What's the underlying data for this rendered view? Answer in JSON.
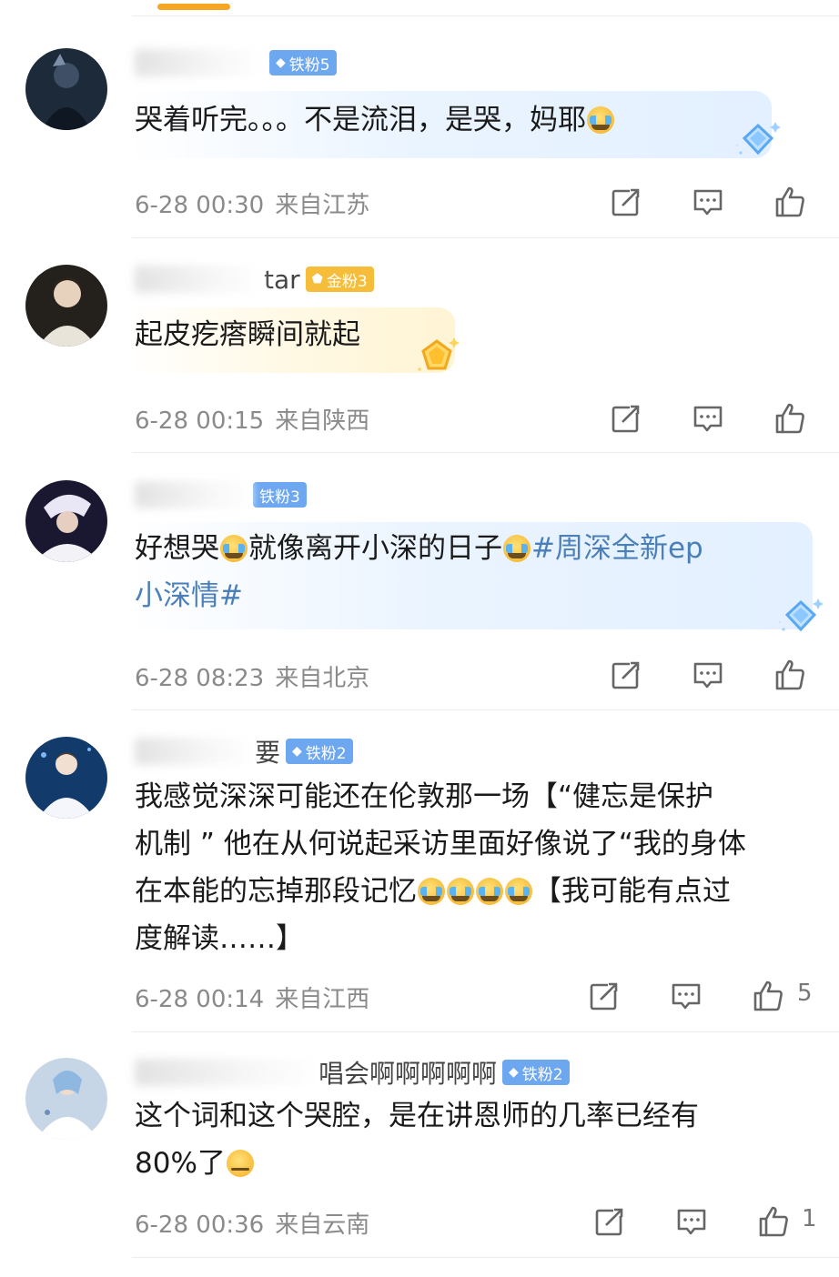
{
  "comments": [
    {
      "name_visible": "",
      "badge": "铁粉5",
      "badge_kind": "iron",
      "text": "哭着听完。。。不是流泪，是哭，妈耶",
      "time": "6-28 00:30",
      "location": "来自江苏",
      "likes": ""
    },
    {
      "name_visible": "tar",
      "badge": "金粉3",
      "badge_kind": "gold",
      "text": "起皮疙瘩瞬间就起",
      "time": "6-28 00:15",
      "location": "来自陕西",
      "likes": ""
    },
    {
      "name_visible": "",
      "badge": "铁粉3",
      "badge_kind": "iron",
      "text_part1": "好想哭",
      "text_part2": "就像离开小深的日子",
      "hashtag_line1": "#周深全新ep",
      "hashtag_line2": "小深情#",
      "time": "6-28 08:23",
      "location": "来自北京",
      "likes": ""
    },
    {
      "name_visible": "要",
      "badge": "铁粉2",
      "badge_kind": "iron",
      "line1": "我感觉深深可能还在伦敦那一场【“健忘是保护",
      "line2": "机制 ” 他在从何说起采访里面好像说了“我的身体",
      "line3a": "在本能的忘掉那段记忆",
      "line3b": "【我可能有点过",
      "line4": "度解读……】",
      "time": "6-28 00:14",
      "location": "来自江西",
      "likes": "5"
    },
    {
      "name_visible": "唱会啊啊啊啊啊",
      "badge": "铁粉2",
      "badge_kind": "iron",
      "line1": "这个词和这个哭腔，是在讲恩师的几率已经有",
      "line2": "80%了",
      "time": "6-28 00:36",
      "location": "来自云南",
      "likes": "1"
    }
  ],
  "icons": {
    "repost": "repost-icon",
    "comment": "comment-icon",
    "like": "thumbs-up-icon",
    "badge_gem": "diamond-icon"
  },
  "colors": {
    "accent": "#f5a623",
    "hashtag": "#4a7fb8",
    "iron_badge": "#6ca7f0",
    "gold_badge": "#f5bd3a",
    "meta_text": "#8a8a8a"
  }
}
